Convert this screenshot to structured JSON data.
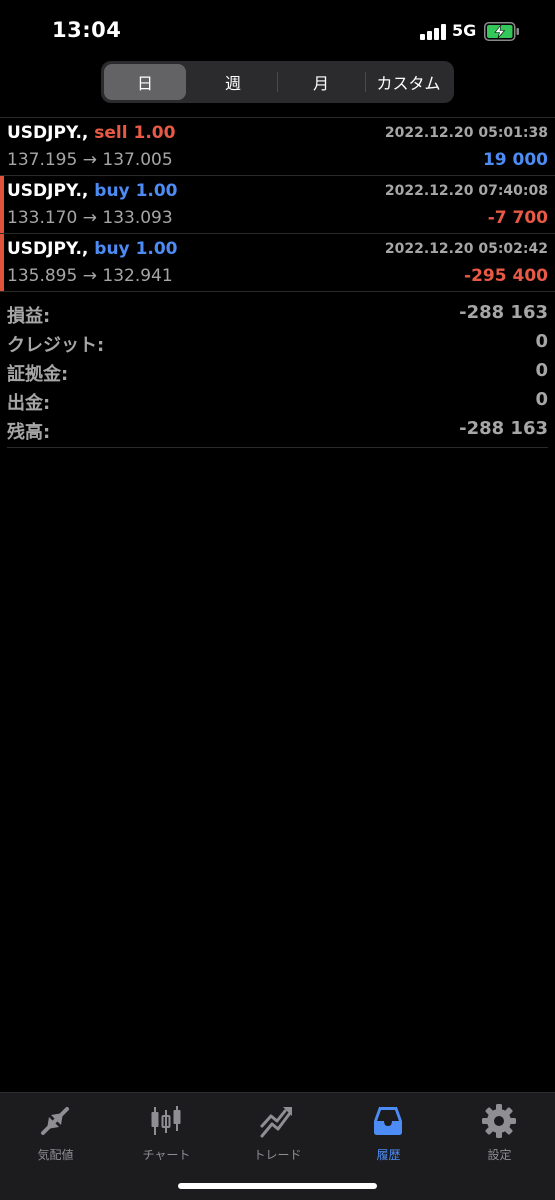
{
  "status_bar": {
    "time": "13:04",
    "network": "5G"
  },
  "period_tabs": [
    {
      "label": "日",
      "active": true
    },
    {
      "label": "週",
      "active": false
    },
    {
      "label": "月",
      "active": false
    },
    {
      "label": "カスタム",
      "active": false
    }
  ],
  "deals": [
    {
      "symbol": "USDJPY.,",
      "side": "sell",
      "volume": "1.00",
      "time": "2022.12.20 05:01:38",
      "open_price": "137.195",
      "arrow": "→",
      "close_price": "137.005",
      "profit": "19 000"
    },
    {
      "symbol": "USDJPY.,",
      "side": "buy",
      "volume": "1.00",
      "time": "2022.12.20 07:40:08",
      "open_price": "133.170",
      "arrow": "→",
      "close_price": "133.093",
      "profit": "-7 700"
    },
    {
      "symbol": "USDJPY.,",
      "side": "buy",
      "volume": "1.00",
      "time": "2022.12.20 05:02:42",
      "open_price": "135.895",
      "arrow": "→",
      "close_price": "132.941",
      "profit": "-295 400"
    }
  ],
  "summary": [
    {
      "label": "損益:",
      "value": "-288 163"
    },
    {
      "label": "クレジット:",
      "value": "0"
    },
    {
      "label": "証拠金:",
      "value": "0"
    },
    {
      "label": "出金:",
      "value": "0"
    },
    {
      "label": "残高:",
      "value": "-288 163"
    }
  ],
  "tab_bar": [
    {
      "label": "気配値",
      "icon": "quotes-arrows-icon",
      "active": false
    },
    {
      "label": "チャート",
      "icon": "candlestick-chart-icon",
      "active": false
    },
    {
      "label": "トレード",
      "icon": "trade-chart-icon",
      "active": false
    },
    {
      "label": "履歴",
      "icon": "history-inbox-icon",
      "active": true
    },
    {
      "label": "設定",
      "icon": "gear-icon",
      "active": false
    }
  ],
  "colors": {
    "sell": "#e85a45",
    "buy": "#4d8cf5",
    "profit_positive": "#4d8cf5",
    "profit_negative": "#e85a45",
    "accent": "#4d8cf5"
  }
}
